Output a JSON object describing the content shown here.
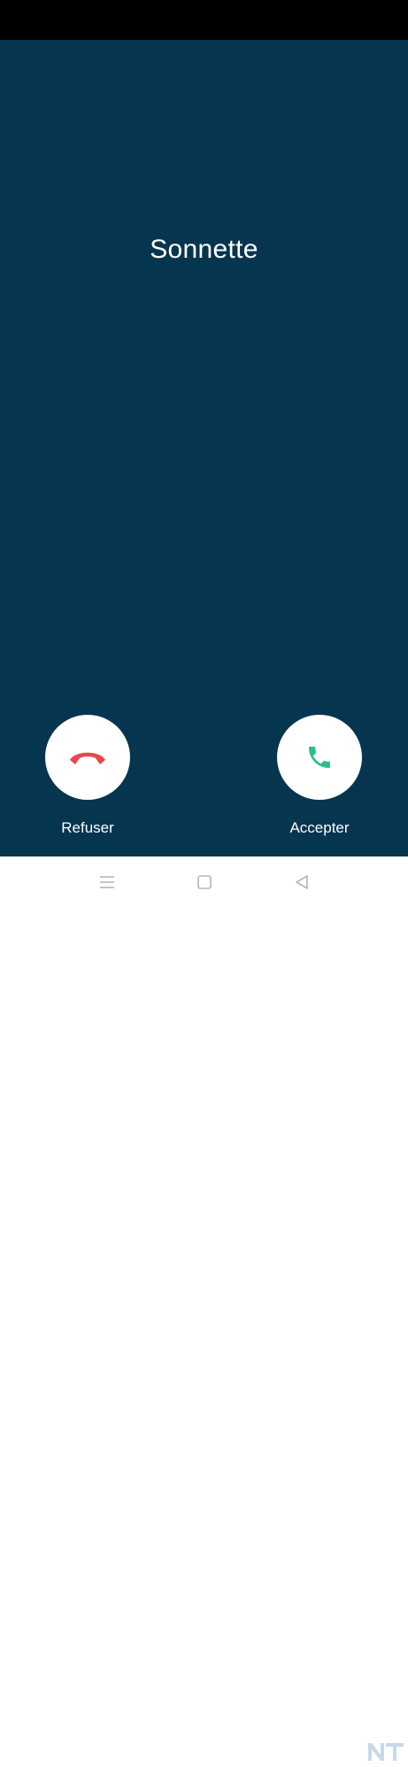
{
  "caller": {
    "name": "Sonnette"
  },
  "actions": {
    "decline": {
      "label": "Refuser",
      "icon": "phone-hangup-icon",
      "color": "#e5484d"
    },
    "accept": {
      "label": "Accepter",
      "icon": "phone-icon",
      "color": "#2bbf8a"
    }
  },
  "navigation": {
    "menu_icon": "menu-icon",
    "home_icon": "home-icon",
    "back_icon": "back-icon"
  },
  "watermark": {
    "text": "NT"
  },
  "colors": {
    "background": "#06354f",
    "status_bar": "#000000",
    "nav_bar": "#ffffff"
  }
}
